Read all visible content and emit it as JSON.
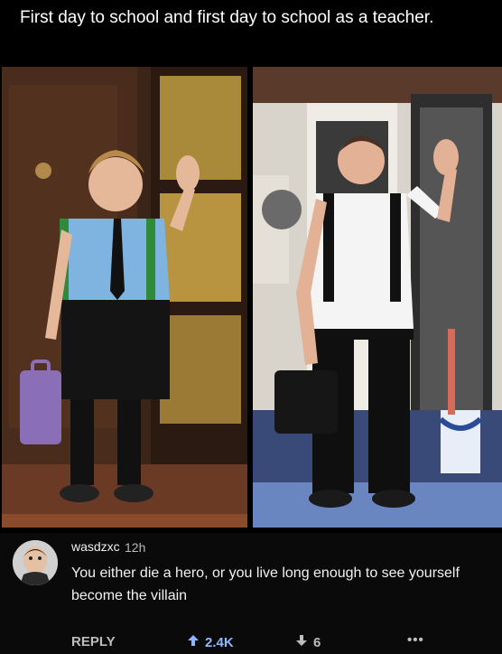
{
  "post": {
    "caption": "First day to school and first day to school as a teacher."
  },
  "comment": {
    "username": "wasdzxc",
    "age": "12h",
    "text": "You either die a hero, or you live long enough to see yourself become the villain",
    "actions": {
      "reply_label": "REPLY",
      "upvotes": "2.4K",
      "downvotes": "6",
      "more_label": "•••"
    }
  },
  "icons": {
    "upvote": "arrow-up-icon",
    "downvote": "arrow-down-icon",
    "more": "ellipsis-icon"
  },
  "colors": {
    "background": "#000000",
    "upvote_accent": "#8fb7ff"
  }
}
